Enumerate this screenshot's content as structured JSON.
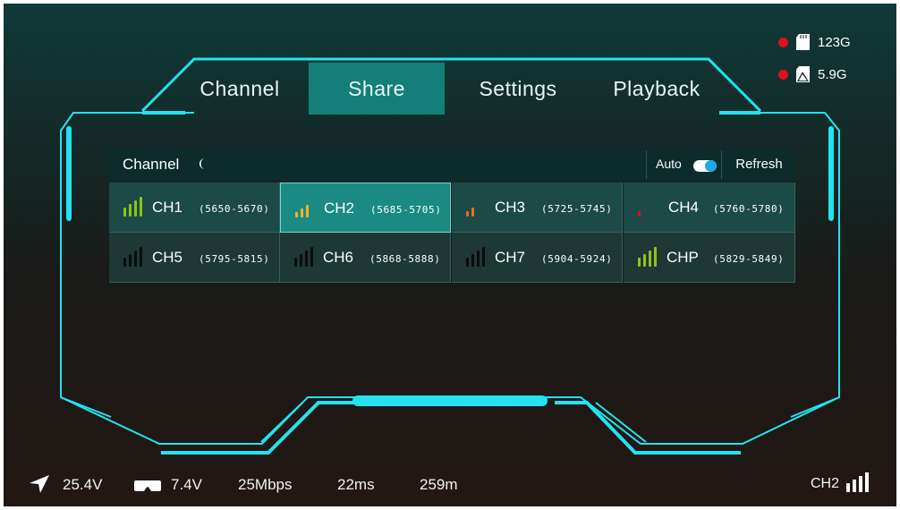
{
  "colors": {
    "frame": "#22e3ef",
    "signal_green": "#8ec41c",
    "signal_yellow": "#f0b323",
    "signal_orange": "#e6731a",
    "signal_red": "#e0101a",
    "record_dot": "#e0101a",
    "toggle_on": "#1ea7ea"
  },
  "tabs": [
    {
      "label": "Channel",
      "active": true
    },
    {
      "label": "Share",
      "active": false
    },
    {
      "label": "Settings",
      "active": false
    },
    {
      "label": "Playback",
      "active": false
    }
  ],
  "storage": [
    {
      "icon": "sd-card-icon",
      "value": "123G"
    },
    {
      "icon": "storage-icon",
      "value": "5.9G"
    }
  ],
  "panel": {
    "title": "Channel",
    "title_icon": "moon-icon",
    "auto_label": "Auto",
    "auto_enabled": true,
    "refresh_label": "Refresh"
  },
  "channels": [
    {
      "name": "CH1",
      "freq": "(5650-5670)",
      "signal_bars": 4,
      "signal_color": "green",
      "selected": false
    },
    {
      "name": "CH2",
      "freq": "(5685-5705)",
      "signal_bars": 3,
      "signal_color": "yellow",
      "selected": true
    },
    {
      "name": "CH3",
      "freq": "(5725-5745)",
      "signal_bars": 2,
      "signal_color": "orange",
      "selected": false
    },
    {
      "name": "CH4",
      "freq": "(5760-5780)",
      "signal_bars": 1,
      "signal_color": "red",
      "selected": false
    },
    {
      "name": "CH5",
      "freq": "(5795-5815)",
      "signal_bars": 0,
      "signal_color": "none",
      "selected": false
    },
    {
      "name": "CH6",
      "freq": "(5868-5888)",
      "signal_bars": 0,
      "signal_color": "none",
      "selected": false
    },
    {
      "name": "CH7",
      "freq": "(5904-5924)",
      "signal_bars": 0,
      "signal_color": "none",
      "selected": false
    },
    {
      "name": "CHP",
      "freq": "(5829-5849)",
      "signal_bars": 4,
      "signal_color": "green",
      "selected": false
    }
  ],
  "status_bar": {
    "voltage_main": "25.4V",
    "voltage_goggle": "7.4V",
    "bitrate": "25Mbps",
    "latency": "22ms",
    "distance": "259m",
    "current_channel": "CH2",
    "current_signal_bars": 4
  }
}
